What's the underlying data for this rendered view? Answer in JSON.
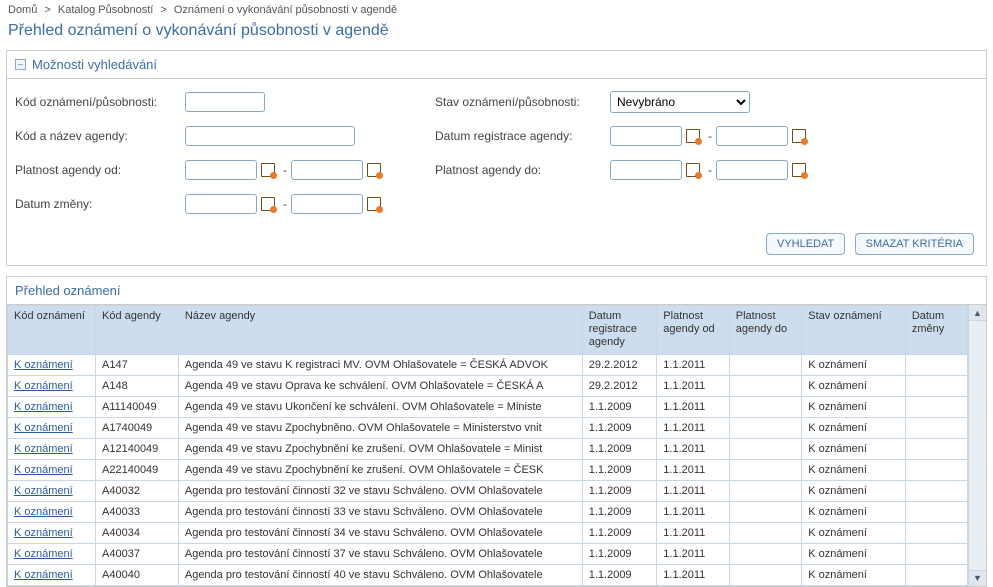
{
  "breadcrumb": {
    "items": [
      "Domů",
      "Katalog Působností",
      "Oznámení o vykonávání působnosti v agendě"
    ],
    "sep": ">"
  },
  "page_title": "Přehled oznámení o vykonávání působnosti v agendě",
  "search_panel": {
    "title": "Možnosti vyhledávání",
    "labels": {
      "kod_oznameni": "Kód oznámení/působnosti:",
      "kod_nazev_agendy": "Kód a název agendy:",
      "platnost_od": "Platnost agendy od:",
      "datum_zmeny": "Datum změny:",
      "stav_oznameni": "Stav oznámení/působnosti:",
      "datum_registrace": "Datum registrace agendy:",
      "platnost_do": "Platnost agendy do:"
    },
    "stav_selected": "Nevybráno",
    "range_sep": "-",
    "buttons": {
      "vyhledat": "VYHLEDAT",
      "smazat": "SMAZAT KRITÉRIA"
    }
  },
  "table_panel": {
    "title": "Přehled oznámení",
    "columns": [
      "Kód oznámení",
      "Kód agendy",
      "Název agendy",
      "Datum registrace agendy",
      "Platnost agendy od",
      "Platnost agendy do",
      "Stav oznámení",
      "Datum změny"
    ],
    "col_widths": [
      "85px",
      "80px",
      "390px",
      "72px",
      "70px",
      "70px",
      "100px",
      "60px"
    ],
    "rows": [
      {
        "link": "K oznámení",
        "kod": "A147",
        "nazev": "Agenda 49 ve stavu K registraci MV. OVM Ohlašovatele = ČESKÁ ADVOK",
        "datum_reg": "29.2.2012",
        "plat_od": "1.1.2011",
        "plat_do": "",
        "stav": "K oznámení",
        "zmena": ""
      },
      {
        "link": "K oznámení",
        "kod": "A148",
        "nazev": "Agenda 49 ve stavu Oprava ke schválení. OVM Ohlašovatele = ČESKÁ A",
        "datum_reg": "29.2.2012",
        "plat_od": "1.1.2011",
        "plat_do": "",
        "stav": "K oznámení",
        "zmena": ""
      },
      {
        "link": "K oznámení",
        "kod": "A11140049",
        "nazev": "Agenda 49 ve stavu Ukončení ke schválení. OVM Ohlašovatele = Ministe",
        "datum_reg": "1.1.2009",
        "plat_od": "1.1.2011",
        "plat_do": "",
        "stav": "K oznámení",
        "zmena": ""
      },
      {
        "link": "K oznámení",
        "kod": "A1740049",
        "nazev": "Agenda 49 ve stavu Zpochybněno. OVM Ohlašovatele = Ministerstvo vnit",
        "datum_reg": "1.1.2009",
        "plat_od": "1.1.2011",
        "plat_do": "",
        "stav": "K oznámení",
        "zmena": ""
      },
      {
        "link": "K oznámení",
        "kod": "A12140049",
        "nazev": "Agenda 49 ve stavu Zpochybnění ke zrušení. OVM Ohlašovatele = Minist",
        "datum_reg": "1.1.2009",
        "plat_od": "1.1.2011",
        "plat_do": "",
        "stav": "K oznámení",
        "zmena": ""
      },
      {
        "link": "K oznámení",
        "kod": "A22140049",
        "nazev": "Agenda 49 ve stavu Zpochybnění ke zrušení. OVM Ohlašovatele = ČESK",
        "datum_reg": "1.1.2009",
        "plat_od": "1.1.2011",
        "plat_do": "",
        "stav": "K oznámení",
        "zmena": ""
      },
      {
        "link": "K oznámení",
        "kod": "A40032",
        "nazev": "Agenda pro testování činností 32 ve stavu Schváleno. OVM Ohlašovatele",
        "datum_reg": "1.1.2009",
        "plat_od": "1.1.2011",
        "plat_do": "",
        "stav": "K oznámení",
        "zmena": ""
      },
      {
        "link": "K oznámení",
        "kod": "A40033",
        "nazev": "Agenda pro testování činností 33 ve stavu Schváleno. OVM Ohlašovatele",
        "datum_reg": "1.1.2009",
        "plat_od": "1.1.2011",
        "plat_do": "",
        "stav": "K oznámení",
        "zmena": ""
      },
      {
        "link": "K oznámení",
        "kod": "A40034",
        "nazev": "Agenda pro testování činností 34 ve stavu Schváleno. OVM Ohlašovatele",
        "datum_reg": "1.1.2009",
        "plat_od": "1.1.2011",
        "plat_do": "",
        "stav": "K oznámení",
        "zmena": ""
      },
      {
        "link": "K oznámení",
        "kod": "A40037",
        "nazev": "Agenda pro testování činností 37 ve stavu Schváleno. OVM Ohlašovatele",
        "datum_reg": "1.1.2009",
        "plat_od": "1.1.2011",
        "plat_do": "",
        "stav": "K oznámení",
        "zmena": ""
      },
      {
        "link": "K oznámení",
        "kod": "A40040",
        "nazev": "Agenda pro testování činností 40 ve stavu Schváleno. OVM Ohlašovatele",
        "datum_reg": "1.1.2009",
        "plat_od": "1.1.2011",
        "plat_do": "",
        "stav": "K oznámení",
        "zmena": ""
      }
    ]
  }
}
